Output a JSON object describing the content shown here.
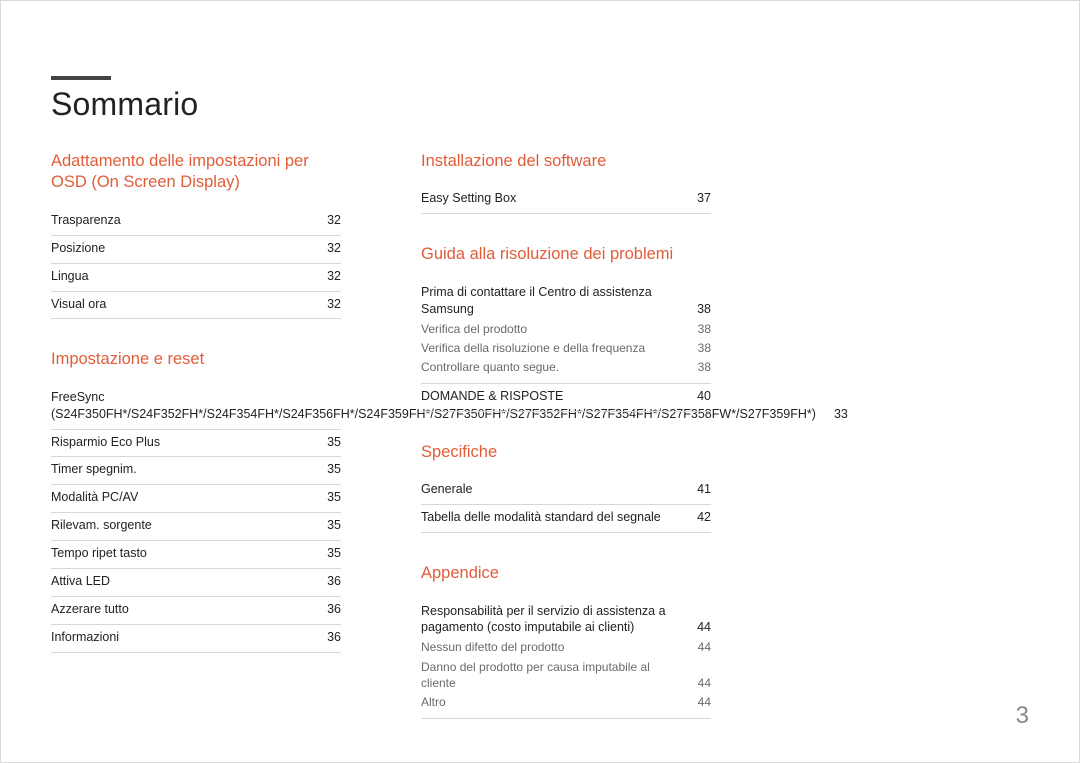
{
  "title": "Sommario",
  "page_number": "3",
  "columns": [
    {
      "sections": [
        {
          "title": "Adattamento delle impostazioni per OSD (On Screen Display)",
          "entries": [
            {
              "label": "Trasparenza",
              "page": "32"
            },
            {
              "label": "Posizione",
              "page": "32"
            },
            {
              "label": "Lingua",
              "page": "32"
            },
            {
              "label": "Visual ora",
              "page": "32"
            }
          ]
        },
        {
          "title": "Impostazione e reset",
          "entries": [
            {
              "label": "FreeSync (S24F350FH*/S24F352FH*/S24F354FH*/S24F356FH*/S24F359FH*/S27F350FH*/S27F352FH*/S27F354FH*/S27F358FW*/S27F359FH*)",
              "page": "33"
            },
            {
              "label": "Risparmio Eco Plus",
              "page": "35"
            },
            {
              "label": "Timer spegnim.",
              "page": "35"
            },
            {
              "label": "Modalità PC/AV",
              "page": "35"
            },
            {
              "label": "Rilevam. sorgente",
              "page": "35"
            },
            {
              "label": "Tempo ripet tasto",
              "page": "35"
            },
            {
              "label": "Attiva LED",
              "page": "36"
            },
            {
              "label": "Azzerare tutto",
              "page": "36"
            },
            {
              "label": "Informazioni",
              "page": "36"
            }
          ]
        }
      ]
    },
    {
      "sections": [
        {
          "title": "Installazione del software",
          "entries": [
            {
              "label": "Easy Setting Box",
              "page": "37"
            }
          ]
        },
        {
          "title": "Guida alla risoluzione dei problemi",
          "entries": [
            {
              "label": "Prima di contattare il Centro di assistenza Samsung",
              "page": "38",
              "subs": [
                {
                  "label": "Verifica del prodotto",
                  "page": "38"
                },
                {
                  "label": "Verifica della risoluzione e della frequenza",
                  "page": "38"
                },
                {
                  "label": "Controllare quanto segue.",
                  "page": "38"
                }
              ]
            },
            {
              "label": "DOMANDE & RISPOSTE",
              "page": "40"
            }
          ]
        },
        {
          "title": "Specifiche",
          "entries": [
            {
              "label": "Generale",
              "page": "41"
            },
            {
              "label": "Tabella delle modalità standard del segnale",
              "page": "42"
            }
          ]
        },
        {
          "title": "Appendice",
          "entries": [
            {
              "label": "Responsabilità per il servizio di assistenza a pagamento (costo imputabile ai clienti)",
              "page": "44",
              "subs": [
                {
                  "label": "Nessun difetto del prodotto",
                  "page": "44"
                },
                {
                  "label": "Danno del prodotto per causa imputabile al cliente",
                  "page": "44"
                },
                {
                  "label": "Altro",
                  "page": "44"
                }
              ]
            }
          ]
        }
      ]
    }
  ]
}
